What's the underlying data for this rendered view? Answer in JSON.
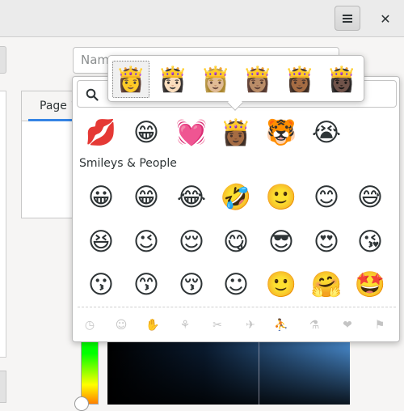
{
  "window": {
    "menu_icon": "hamburger-menu-icon",
    "close_glyph": "✕"
  },
  "background": {
    "name_placeholder": "Name",
    "notebook_tab": "Page 1"
  },
  "emoji_chooser": {
    "search_placeholder": "",
    "recent": [
      "💋",
      "😁",
      "💓",
      "👸🏾",
      "🐯",
      "😭"
    ],
    "section_title": "Smileys & People",
    "rows": [
      [
        "😀",
        "😁",
        "😂",
        "🤣",
        "🙂",
        "😊",
        "😅"
      ],
      [
        "😆",
        "😉",
        "😌",
        "😋",
        "😎",
        "😍",
        "😘"
      ],
      [
        "😗",
        "😙",
        "😚",
        "☺",
        "🙂",
        "🤗",
        "🤩"
      ]
    ],
    "categories": [
      {
        "name": "recent-category-icon",
        "glyph": "◷"
      },
      {
        "name": "smileys-category-icon",
        "glyph": "☺"
      },
      {
        "name": "body-category-icon",
        "glyph": "✋"
      },
      {
        "name": "nature-category-icon",
        "glyph": "⚘"
      },
      {
        "name": "food-category-icon",
        "glyph": "✂"
      },
      {
        "name": "travel-category-icon",
        "glyph": "✈"
      },
      {
        "name": "activities-category-icon",
        "glyph": "⛹"
      },
      {
        "name": "objects-category-icon",
        "glyph": "⚗"
      },
      {
        "name": "symbols-category-icon",
        "glyph": "❤"
      },
      {
        "name": "flags-category-icon",
        "glyph": "⚑"
      }
    ]
  },
  "skin_tones": {
    "variants": [
      "👸",
      "👸🏻",
      "👸🏼",
      "👸🏽",
      "👸🏾",
      "👸🏿"
    ],
    "selected_index": 0
  },
  "colors": {
    "accent": "#3584e4",
    "popover_border": "#bdbdbd"
  }
}
